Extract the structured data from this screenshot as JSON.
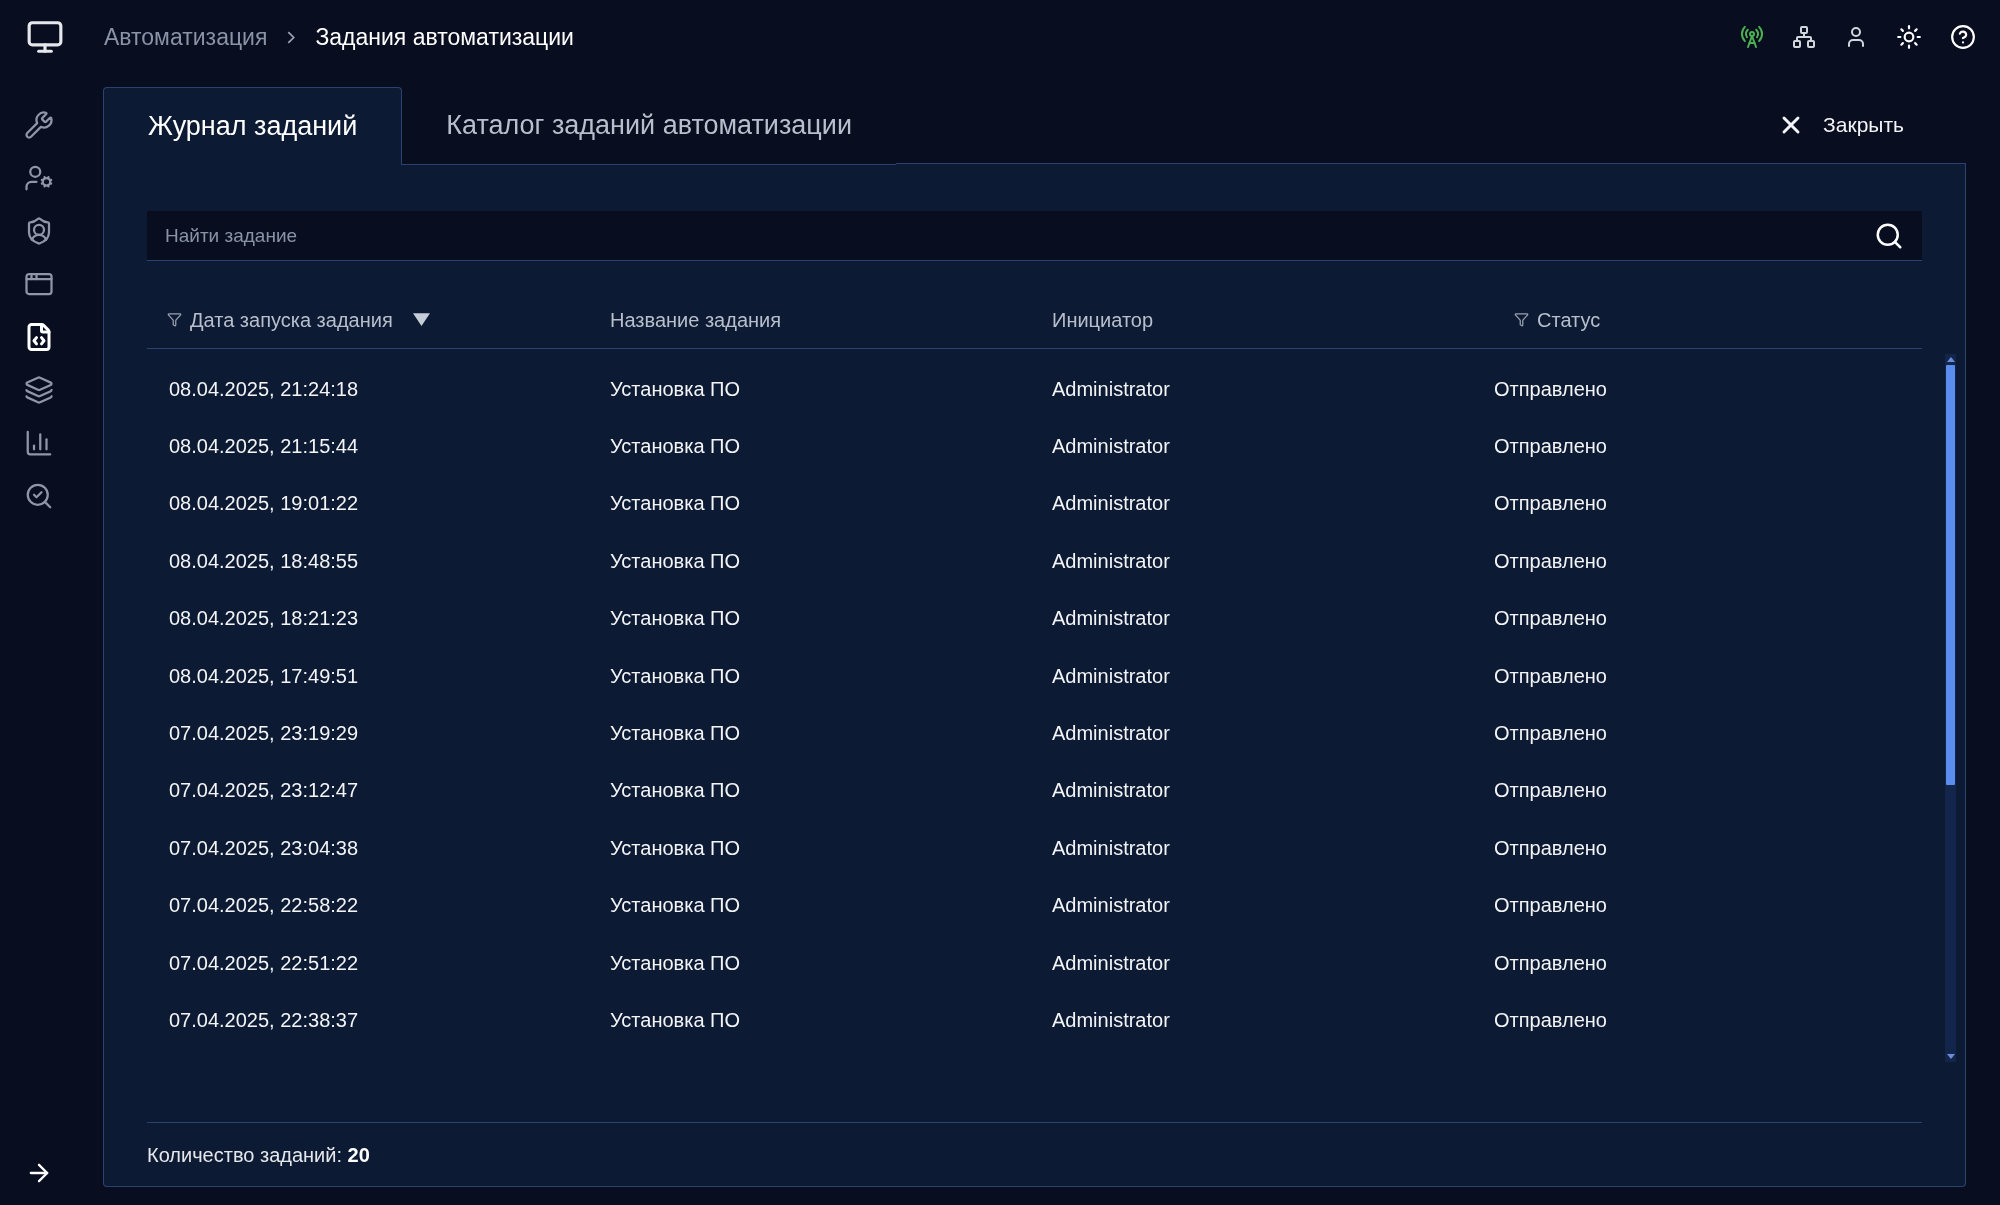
{
  "breadcrumb": [
    {
      "label": "Автоматизация",
      "current": false
    },
    {
      "label": "Задания автоматизации",
      "current": true
    }
  ],
  "sidebar": {
    "items": [
      {
        "kind": "tools",
        "selected": false
      },
      {
        "kind": "user-settings",
        "selected": false
      },
      {
        "kind": "shield",
        "selected": false
      },
      {
        "kind": "window",
        "selected": false
      },
      {
        "kind": "code-file",
        "selected": true
      },
      {
        "kind": "layers",
        "selected": false
      },
      {
        "kind": "chart",
        "selected": false
      },
      {
        "kind": "search",
        "selected": false
      }
    ]
  },
  "tabs": [
    {
      "label": "Журнал заданий",
      "selected": true
    },
    {
      "label": "Каталог заданий автоматизации",
      "selected": false
    }
  ],
  "close_button": {
    "label": "Закрыть"
  },
  "search": {
    "placeholder": "Найти задание"
  },
  "table": {
    "columns": [
      {
        "label": "Дата запуска задания",
        "filterable": true,
        "sorted": true
      },
      {
        "label": "Название задания",
        "filterable": false,
        "sorted": false
      },
      {
        "label": "Инициатор",
        "filterable": false,
        "sorted": false
      },
      {
        "label": "Статус",
        "filterable": true,
        "sorted": false
      }
    ],
    "rows": [
      [
        "08.04.2025, 21:24:18",
        "Установка ПО",
        "Administrator",
        "Отправлено"
      ],
      [
        "08.04.2025, 21:15:44",
        "Установка ПО",
        "Administrator",
        "Отправлено"
      ],
      [
        "08.04.2025, 19:01:22",
        "Установка ПО",
        "Administrator",
        "Отправлено"
      ],
      [
        "08.04.2025, 18:48:55",
        "Установка ПО",
        "Administrator",
        "Отправлено"
      ],
      [
        "08.04.2025, 18:21:23",
        "Установка ПО",
        "Administrator",
        "Отправлено"
      ],
      [
        "08.04.2025, 17:49:51",
        "Установка ПО",
        "Administrator",
        "Отправлено"
      ],
      [
        "07.04.2025, 23:19:29",
        "Установка ПО",
        "Administrator",
        "Отправлено"
      ],
      [
        "07.04.2025, 23:12:47",
        "Установка ПО",
        "Administrator",
        "Отправлено"
      ],
      [
        "07.04.2025, 23:04:38",
        "Установка ПО",
        "Administrator",
        "Отправлено"
      ],
      [
        "07.04.2025, 22:58:22",
        "Установка ПО",
        "Administrator",
        "Отправлено"
      ],
      [
        "07.04.2025, 22:51:22",
        "Установка ПО",
        "Administrator",
        "Отправлено"
      ],
      [
        "07.04.2025, 22:38:37",
        "Установка ПО",
        "Administrator",
        "Отправлено"
      ]
    ]
  },
  "footer": {
    "label": "Количество заданий:",
    "count": "20"
  }
}
